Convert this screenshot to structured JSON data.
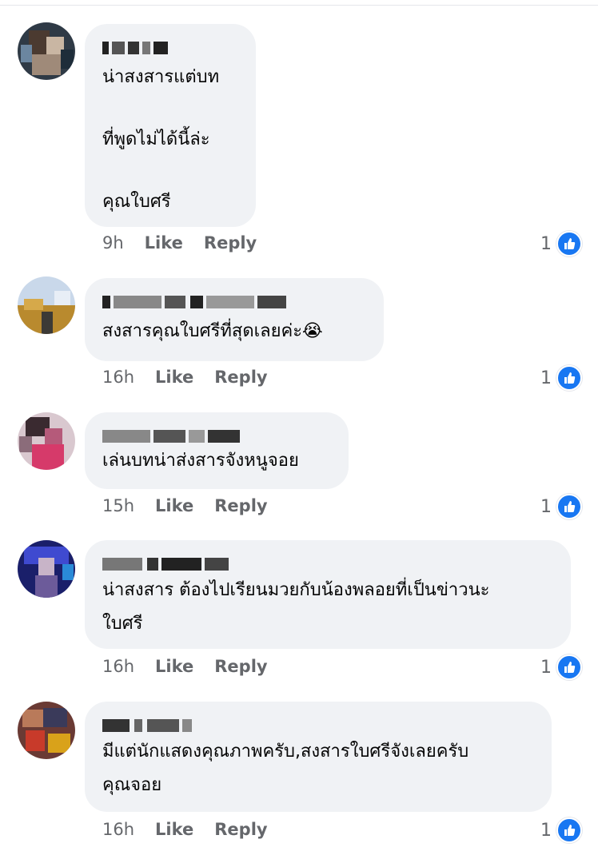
{
  "labels": {
    "like": "Like",
    "reply": "Reply"
  },
  "reaction_icon": "thumbs-up-icon",
  "accent_color": "#1877f2",
  "comments": [
    {
      "name": "",
      "lines": [
        "น่าสงสารแต่บท",
        "ที่พูดไม่ได้นี้ล่ะ",
        "คุณใบศรี"
      ],
      "time": "9h",
      "likes": "1"
    },
    {
      "name": "",
      "lines": [
        "สงสารคุณใบศรีที่สุดเลยค่ะ😭"
      ],
      "time": "16h",
      "likes": "1"
    },
    {
      "name": "",
      "lines": [
        "เล่นบทน่าส่งสารจังหนูจอย"
      ],
      "time": "15h",
      "likes": "1"
    },
    {
      "name": "",
      "lines": [
        "น่าสงสาร ต้องไปเรียนมวยกับน้องพลอยที่เป็นข่าวนะ",
        "ใบศรี"
      ],
      "time": "16h",
      "likes": "1"
    },
    {
      "name": "",
      "lines": [
        "มีแต่นักแสดงคุณภาพครับ,สงสารใบศรีจังเลยครับ",
        "คุณจอย"
      ],
      "time": "16h",
      "likes": "1"
    }
  ]
}
